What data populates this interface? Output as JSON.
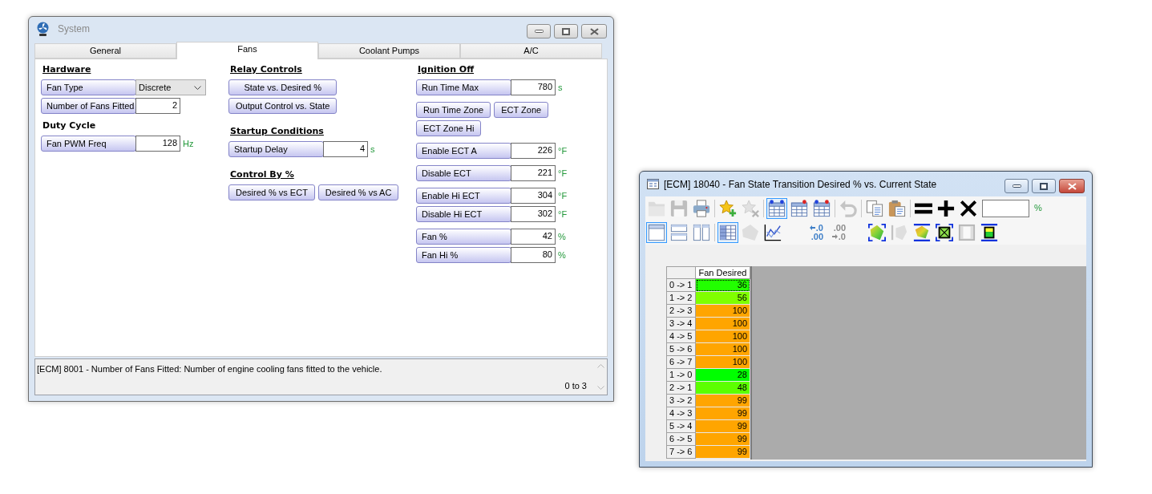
{
  "system_window": {
    "title": "System",
    "tabs": [
      {
        "label": "General",
        "selected": false
      },
      {
        "label": "Fans",
        "selected": true
      },
      {
        "label": "Coolant Pumps",
        "selected": false
      },
      {
        "label": "A/C",
        "selected": false
      }
    ],
    "columns": [
      {
        "sections": [
          {
            "heading": "Hardware",
            "underlined": true,
            "groups": [
              [
                [
                  {
                    "kind": "dropdown",
                    "label": "Fan Type",
                    "value": "Discrete"
                  }
                ],
                [
                  {
                    "kind": "field",
                    "label": "Number of Fans Fitted",
                    "value": "2"
                  }
                ]
              ]
            ]
          },
          {
            "heading": "Duty Cycle",
            "underlined": false,
            "groups": [
              [
                [
                  {
                    "kind": "field",
                    "label": "Fan PWM Freq",
                    "value": "128",
                    "unit": "Hz"
                  }
                ]
              ]
            ]
          }
        ]
      },
      {
        "sections": [
          {
            "heading": "Relay Controls",
            "underlined": true,
            "groups": [
              [
                [
                  {
                    "kind": "button",
                    "label": "State vs. Desired %"
                  }
                ],
                [
                  {
                    "kind": "button",
                    "label": "Output Control vs. State"
                  }
                ]
              ]
            ]
          },
          {
            "heading": "Startup Conditions",
            "underlined": true,
            "groups": [
              [
                [
                  {
                    "kind": "field",
                    "label": "Startup Delay",
                    "value": "4",
                    "unit": "s"
                  }
                ]
              ]
            ]
          },
          {
            "heading": "Control By %",
            "underlined": true,
            "groups": [
              [
                [
                  {
                    "kind": "button",
                    "label": "Desired % vs ECT"
                  },
                  {
                    "kind": "button",
                    "label": "Desired % vs AC"
                  }
                ]
              ]
            ]
          }
        ]
      },
      {
        "sections": [
          {
            "heading": "Ignition Off",
            "underlined": true,
            "groups": [
              [
                [
                  {
                    "kind": "field",
                    "label": "Run Time Max",
                    "value": "780",
                    "unit": "s"
                  }
                ]
              ],
              [
                [
                  {
                    "kind": "button",
                    "label": "Run Time Zone"
                  },
                  {
                    "kind": "button",
                    "label": "ECT Zone"
                  }
                ],
                [
                  {
                    "kind": "button",
                    "label": "ECT Zone Hi"
                  }
                ]
              ],
              [
                [
                  {
                    "kind": "field",
                    "label": "Enable ECT A",
                    "value": "226",
                    "unit": "°F"
                  }
                ]
              ],
              [
                [
                  {
                    "kind": "field",
                    "label": "Disable ECT",
                    "value": "221",
                    "unit": "°F"
                  }
                ]
              ],
              [
                [
                  {
                    "kind": "field",
                    "label": "Enable Hi ECT",
                    "value": "304",
                    "unit": "°F"
                  }
                ],
                [
                  {
                    "kind": "field",
                    "label": "Disable Hi ECT",
                    "value": "302",
                    "unit": "°F"
                  }
                ]
              ],
              [
                [
                  {
                    "kind": "field",
                    "label": "Fan %",
                    "value": "42",
                    "unit": "%"
                  }
                ],
                [
                  {
                    "kind": "field",
                    "label": "Fan Hi %",
                    "value": "80",
                    "unit": "%"
                  }
                ]
              ]
            ]
          }
        ]
      }
    ],
    "status": {
      "description": "[ECM] 8001 - Number of Fans Fitted: Number of engine cooling fans fitted to the vehicle.",
      "range": "0 to 3"
    }
  },
  "table_window": {
    "title": "[ECM] 18040 - Fan State Transition Desired % vs. Current State",
    "toolbar": {
      "rows": [
        [
          [
            {
              "disabled": true,
              "selected": false
            },
            {
              "disabled": true,
              "selected": false
            },
            {
              "disabled": false,
              "selected": false
            }
          ],
          [
            {
              "disabled": false,
              "selected": false
            },
            {
              "disabled": true,
              "selected": false
            }
          ],
          [
            {
              "disabled": false,
              "selected": true
            },
            {
              "disabled": false,
              "selected": false
            },
            {
              "disabled": false,
              "selected": false
            }
          ],
          [
            {
              "disabled": true,
              "selected": false
            }
          ],
          [
            {
              "disabled": false,
              "selected": false
            },
            {
              "disabled": false,
              "selected": false
            }
          ],
          [
            {
              "disabled": false,
              "selected": false
            },
            {
              "disabled": false,
              "selected": false
            },
            {
              "disabled": false,
              "selected": false
            }
          ]
        ],
        [
          [
            {
              "disabled": false,
              "selected": true
            },
            {
              "disabled": false,
              "selected": false
            },
            {
              "disabled": false,
              "selected": false
            }
          ],
          [
            {
              "disabled": false,
              "selected": true
            },
            {
              "disabled": true,
              "selected": false
            },
            {
              "disabled": false,
              "selected": false
            }
          ],
          [
            {
              "top": ".0",
              "bottom": ".00",
              "disabled": false,
              "selected": false
            },
            {
              "top": ".00",
              "bottom": ".0",
              "disabled": true,
              "selected": false
            }
          ],
          [
            {
              "disabled": false,
              "selected": false
            },
            {
              "disabled": true,
              "selected": false
            },
            {
              "disabled": false,
              "selected": false
            },
            {
              "disabled": false,
              "selected": false
            },
            {
              "disabled": true,
              "selected": false
            },
            {
              "disabled": false,
              "selected": false
            }
          ]
        ]
      ],
      "unit": "%"
    },
    "table": {
      "column_header": "Fan Desired",
      "rows": [
        {
          "label": "0 -> 1",
          "value": "36",
          "color": "#22ff00",
          "selected": true
        },
        {
          "label": "1 -> 2",
          "value": "56",
          "color": "#80ff00",
          "selected": false
        },
        {
          "label": "2 -> 3",
          "value": "100",
          "color": "#ffa500",
          "selected": false
        },
        {
          "label": "3 -> 4",
          "value": "100",
          "color": "#ffa500",
          "selected": false
        },
        {
          "label": "4 -> 5",
          "value": "100",
          "color": "#ffa500",
          "selected": false
        },
        {
          "label": "5 -> 6",
          "value": "100",
          "color": "#ffa500",
          "selected": false
        },
        {
          "label": "6 -> 7",
          "value": "100",
          "color": "#ffa500",
          "selected": false
        },
        {
          "label": "1 -> 0",
          "value": "28",
          "color": "#00ff00",
          "selected": false
        },
        {
          "label": "2 -> 1",
          "value": "48",
          "color": "#5cff00",
          "selected": false
        },
        {
          "label": "3 -> 2",
          "value": "99",
          "color": "#ffa500",
          "selected": false
        },
        {
          "label": "4 -> 3",
          "value": "99",
          "color": "#ffa500",
          "selected": false
        },
        {
          "label": "5 -> 4",
          "value": "99",
          "color": "#ffa500",
          "selected": false
        },
        {
          "label": "6 -> 5",
          "value": "99",
          "color": "#ffa500",
          "selected": false
        },
        {
          "label": "7 -> 6",
          "value": "99",
          "color": "#ffa500",
          "selected": false
        }
      ]
    }
  }
}
